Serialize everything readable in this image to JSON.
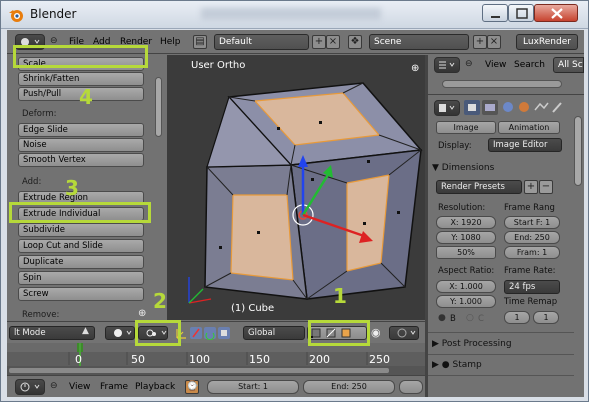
{
  "window": {
    "title": "Blender"
  },
  "top_header": {
    "menus": [
      "File",
      "Add",
      "Render",
      "Help"
    ],
    "screen_layout": "Default",
    "scene": "Scene",
    "render_engine": "LuxRender"
  },
  "tool_shelf": {
    "transform_buttons": [
      "Scale",
      "Shrink/Fatten",
      "Push/Pull"
    ],
    "deform_label": "Deform:",
    "deform_buttons": [
      "Edge Slide",
      "Noise",
      "Smooth Vertex"
    ],
    "add_label": "Add:",
    "add_buttons": [
      "Extrude Region",
      "Extrude Individual",
      "Subdivide",
      "Loop Cut and Slide",
      "Duplicate",
      "Spin",
      "Screw"
    ],
    "remove_label": "Remove:"
  },
  "viewport": {
    "view_label": "User Ortho",
    "object_label": "(1) Cube"
  },
  "viewport_header": {
    "mode": "Edit Mode",
    "mode_visible": "lt Mode",
    "orientation": "Global"
  },
  "annotations": {
    "n1": "1",
    "n2": "2",
    "n3": "3",
    "n4": "4"
  },
  "highlight_color": "#b6d93a",
  "timeline": {
    "ticks": [
      "0",
      "50",
      "100",
      "150",
      "200",
      "250"
    ],
    "current_frame_marker": 1
  },
  "timeline_header": {
    "menus": [
      "View",
      "Frame",
      "Playback"
    ],
    "start": "Start: 1",
    "end": "End: 250"
  },
  "outliner": {
    "menus": [
      "View",
      "Search"
    ],
    "filter": "All Sc"
  },
  "properties": {
    "image_tab": "Image",
    "animation_tab": "Animation",
    "display_label": "Display:",
    "display_value": "Image Editor",
    "dimensions_header": "Dimensions",
    "render_presets": "Render Presets",
    "resolution_label": "Resolution:",
    "frame_range_label": "Frame Rang",
    "res_x": "X: 1920",
    "res_y": "Y: 1080",
    "res_pct": "50%",
    "start_f": "Start F: 1",
    "end_f": "End: 250",
    "frame_step": "Fram: 1",
    "aspect_label": "Aspect Ratio:",
    "frame_rate_label": "Frame Rate:",
    "asp_x": "X: 1.000",
    "asp_y": "Y: 1.000",
    "fps": "24 fps",
    "time_remap_label": "Time Remap",
    "remap_old": "1",
    "remap_new": "1",
    "b_label": "B",
    "c_label": "C",
    "post_processing": "Post Processing",
    "stamp": "Stamp"
  }
}
